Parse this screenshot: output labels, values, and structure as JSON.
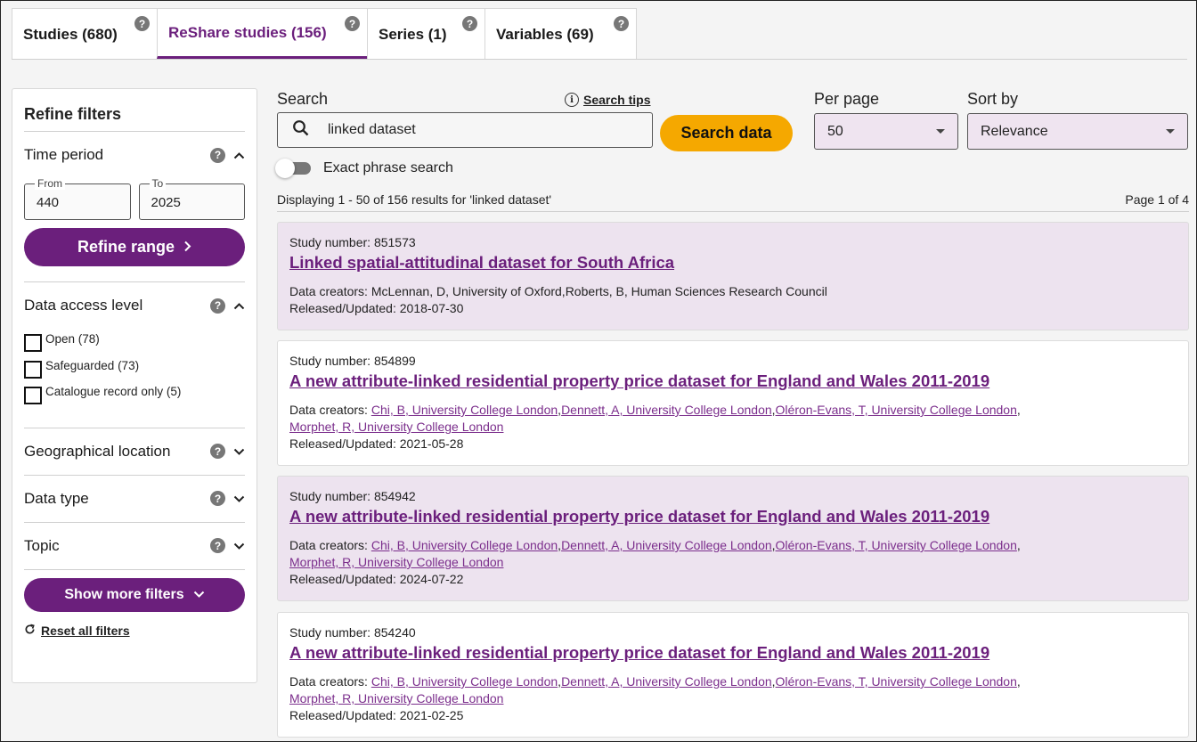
{
  "tabs": [
    {
      "label": "Studies (680)"
    },
    {
      "label": "ReShare studies (156)"
    },
    {
      "label": "Series (1)"
    },
    {
      "label": "Variables (69)"
    }
  ],
  "help_glyph": "?",
  "sidebar": {
    "title": "Refine filters",
    "time_period": {
      "label": "Time period",
      "from_label": "From",
      "from_value": "440",
      "to_label": "To",
      "to_value": "2025",
      "refine_label": "Refine range"
    },
    "access": {
      "label": "Data access level",
      "options": [
        {
          "label": "Open (78)"
        },
        {
          "label": "Safeguarded (73)"
        },
        {
          "label": "Catalogue record only (5)"
        }
      ]
    },
    "geo_label": "Geographical location",
    "data_type_label": "Data type",
    "topic_label": "Topic",
    "more_filters_label": "Show more filters",
    "reset_label": "Reset all filters"
  },
  "search": {
    "label": "Search",
    "tips_label": "Search tips",
    "value": "linked dataset",
    "button_label": "Search data",
    "exact_phrase_label": "Exact phrase search"
  },
  "per_page": {
    "label": "Per page",
    "value": "50"
  },
  "sort": {
    "label": "Sort by",
    "value": "Relevance"
  },
  "summary": {
    "displaying": "Displaying 1 - 50  of 156 results for 'linked dataset'",
    "page": "Page 1 of 4"
  },
  "results_labels": {
    "study_number": "Study number:",
    "creators": "Data creators:",
    "released": "Released/Updated:"
  },
  "results": [
    {
      "number": "851573",
      "title": "Linked spatial-attitudinal dataset for South Africa",
      "creators_text": "McLennan, D, University of Oxford,Roberts, B, Human Sciences Research Council",
      "released": "2018-07-30"
    },
    {
      "number": "854899",
      "title": "A new attribute-linked residential property price dataset for England and Wales 2011-2019",
      "creators": [
        "Chi, B, University College London",
        "Dennett, A, University College London",
        "Oléron-Evans, T, University College London",
        "Morphet, R, University College London"
      ],
      "released": "2021-05-28"
    },
    {
      "number": "854942",
      "title": "A new attribute-linked residential property price dataset for England and Wales 2011-2019",
      "creators": [
        "Chi, B, University College London",
        "Dennett, A, University College London",
        "Oléron-Evans, T, University College London",
        "Morphet, R, University College London"
      ],
      "released": "2024-07-22"
    },
    {
      "number": "854240",
      "title": "A new attribute-linked residential property price dataset for England and Wales 2011-2019",
      "creators": [
        "Chi, B, University College London",
        "Dennett, A, University College London",
        "Oléron-Evans, T, University College London",
        "Morphet, R, University College London"
      ],
      "released": "2021-02-25"
    }
  ]
}
